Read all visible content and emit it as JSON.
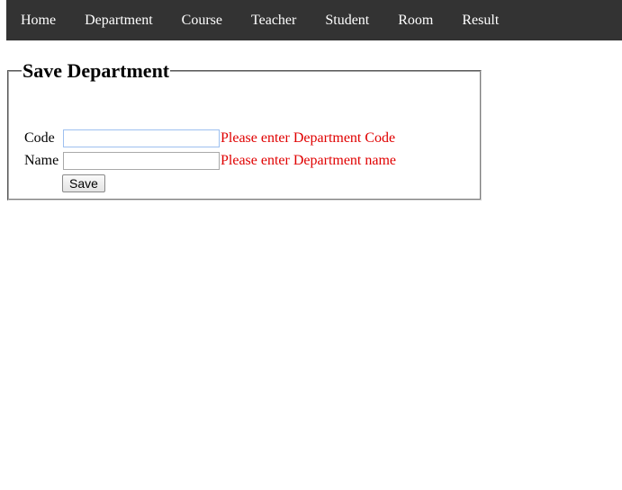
{
  "nav": {
    "items": [
      "Home",
      "Department",
      "Course",
      "Teacher",
      "Student",
      "Room",
      "Result"
    ]
  },
  "form": {
    "legend": "Save Department",
    "code": {
      "label": "Code",
      "value": "",
      "error": "Please enter Department Code"
    },
    "name": {
      "label": "Name",
      "value": "",
      "error": "Please enter Department name"
    },
    "save_label": "Save"
  },
  "colors": {
    "navbar_bg": "#333333",
    "nav_text": "#ffffff",
    "error": "#e00000"
  }
}
